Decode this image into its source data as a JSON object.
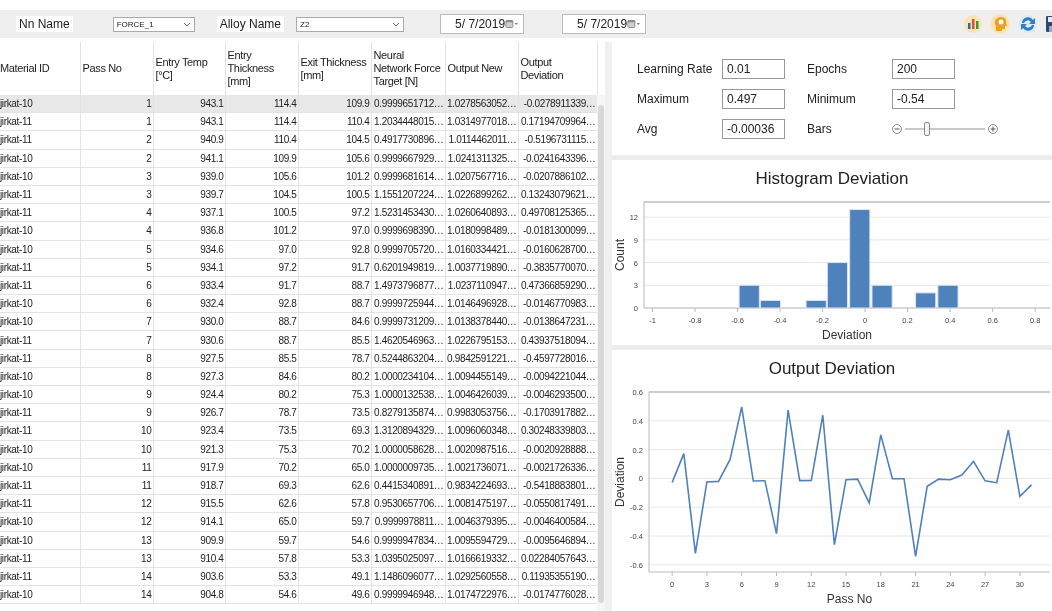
{
  "toolbar": {
    "fields": [
      {
        "label": "Nn Name",
        "value": "FORCE_1"
      },
      {
        "label": "Alloy Name",
        "value": "Z2"
      }
    ],
    "dates": [
      "5/ 7/2019",
      "5/ 7/2019"
    ]
  },
  "table": {
    "columns": [
      "Material ID",
      "Pass No",
      "Entry Temp [°C]",
      "Entry Thickness [mm]",
      "Exit Thickness [mm]",
      "Neural Network Force Target [N]",
      "Output New",
      "Output Deviation"
    ],
    "rows": [
      {
        "selected": true,
        "cells": [
          "jirkat-10",
          "1",
          "943.1",
          "114.4",
          "109.9",
          "0.9999651712…",
          "1.0278563052…",
          "-0.0278911339…"
        ]
      },
      {
        "selected": false,
        "cells": [
          "jirkat-11",
          "1",
          "943.1",
          "114.4",
          "110.4",
          "1.2034448015…",
          "1.0314977018…",
          "0.17194709964…"
        ]
      },
      {
        "selected": false,
        "cells": [
          "jirkat-11",
          "2",
          "940.9",
          "110.4",
          "104.5",
          "0.4917730896…",
          "1.0114462011…",
          "-0.5196731115…"
        ]
      },
      {
        "selected": false,
        "cells": [
          "jirkat-10",
          "2",
          "941.1",
          "109.9",
          "105.6",
          "0.9999667929…",
          "1.0241311325…",
          "-0.0241643396…"
        ]
      },
      {
        "selected": false,
        "cells": [
          "jirkat-10",
          "3",
          "939.0",
          "105.6",
          "101.2",
          "0.9999681614…",
          "1.0207567716…",
          "-0.0207886102…"
        ]
      },
      {
        "selected": false,
        "cells": [
          "jirkat-11",
          "3",
          "939.7",
          "104.5",
          "100.5",
          "1.1551207224…",
          "1.0226899262…",
          "0.13243079621…"
        ]
      },
      {
        "selected": false,
        "cells": [
          "jirkat-11",
          "4",
          "937.1",
          "100.5",
          "97.2",
          "1.5231453430…",
          "1.0260640893…",
          "0.49708125365…"
        ]
      },
      {
        "selected": false,
        "cells": [
          "jirkat-10",
          "4",
          "936.8",
          "101.2",
          "97.0",
          "0.9999698390…",
          "1.0180998489…",
          "-0.0181300099…"
        ]
      },
      {
        "selected": false,
        "cells": [
          "jirkat-10",
          "5",
          "934.6",
          "97.0",
          "92.8",
          "0.9999705720…",
          "1.0160334421…",
          "-0.0160628700…"
        ]
      },
      {
        "selected": false,
        "cells": [
          "jirkat-11",
          "5",
          "934.1",
          "97.2",
          "91.7",
          "0.6201949819…",
          "1.0037719890…",
          "-0.3835770070…"
        ]
      },
      {
        "selected": false,
        "cells": [
          "jirkat-11",
          "6",
          "933.4",
          "91.7",
          "88.7",
          "1.4973796877…",
          "1.0237110947…",
          "0.47366859290…"
        ]
      },
      {
        "selected": false,
        "cells": [
          "jirkat-10",
          "6",
          "932.4",
          "92.8",
          "88.7",
          "0.9999725944…",
          "1.0146496928…",
          "-0.0146770983…"
        ]
      },
      {
        "selected": false,
        "cells": [
          "jirkat-10",
          "7",
          "930.0",
          "88.7",
          "84.6",
          "0.9999731209…",
          "1.0138378440…",
          "-0.0138647231…"
        ]
      },
      {
        "selected": false,
        "cells": [
          "jirkat-11",
          "7",
          "930.6",
          "88.7",
          "85.5",
          "1.4620546963…",
          "1.0226795153…",
          "0.43937518094…"
        ]
      },
      {
        "selected": false,
        "cells": [
          "jirkat-11",
          "8",
          "927.5",
          "85.5",
          "78.7",
          "0.5244863204…",
          "0.9842591221…",
          "-0.4597728016…"
        ]
      },
      {
        "selected": false,
        "cells": [
          "jirkat-10",
          "8",
          "927.3",
          "84.6",
          "80.2",
          "1.0000234104…",
          "1.0094455149…",
          "-0.0094221044…"
        ]
      },
      {
        "selected": false,
        "cells": [
          "jirkat-10",
          "9",
          "924.4",
          "80.2",
          "75.3",
          "1.0000132538…",
          "1.0046426039…",
          "-0.0046293500…"
        ]
      },
      {
        "selected": false,
        "cells": [
          "jirkat-11",
          "9",
          "926.7",
          "78.7",
          "73.5",
          "0.8279135874…",
          "0.9983053756…",
          "-0.1703917882…"
        ]
      },
      {
        "selected": false,
        "cells": [
          "jirkat-11",
          "10",
          "923.4",
          "73.5",
          "69.3",
          "1.3120894329…",
          "1.0096060348…",
          "0.30248339803…"
        ]
      },
      {
        "selected": false,
        "cells": [
          "jirkat-10",
          "10",
          "921.3",
          "75.3",
          "70.2",
          "1.0000058628…",
          "1.0020987516…",
          "-0.0020928888…"
        ]
      },
      {
        "selected": false,
        "cells": [
          "jirkat-10",
          "11",
          "917.9",
          "70.2",
          "65.0",
          "1.0000009735…",
          "1.0021736071…",
          "-0.0021726336…"
        ]
      },
      {
        "selected": false,
        "cells": [
          "jirkat-11",
          "11",
          "918.7",
          "69.3",
          "62.6",
          "0.4415340891…",
          "0.9834224693…",
          "-0.5418883801…"
        ]
      },
      {
        "selected": false,
        "cells": [
          "jirkat-11",
          "12",
          "915.5",
          "62.6",
          "57.8",
          "0.9530657706…",
          "1.0081475197…",
          "-0.0550817491…"
        ]
      },
      {
        "selected": false,
        "cells": [
          "jirkat-10",
          "12",
          "914.1",
          "65.0",
          "59.7",
          "0.9999978811…",
          "1.0046379395…",
          "-0.0046400584…"
        ]
      },
      {
        "selected": false,
        "cells": [
          "jirkat-10",
          "13",
          "909.9",
          "59.7",
          "54.6",
          "0.9999947834…",
          "1.0095594729…",
          "-0.0095646894…"
        ]
      },
      {
        "selected": false,
        "cells": [
          "jirkat-11",
          "13",
          "910.4",
          "57.8",
          "53.3",
          "1.0395025097…",
          "1.0166619332…",
          "0.02284057643…"
        ]
      },
      {
        "selected": false,
        "cells": [
          "jirkat-11",
          "14",
          "903.6",
          "53.3",
          "49.1",
          "1.1486096077…",
          "1.0292560558…",
          "0.11935355190…"
        ]
      },
      {
        "selected": false,
        "cells": [
          "jirkat-10",
          "14",
          "904.8",
          "54.6",
          "49.6",
          "0.9999946948…",
          "1.0174722976…",
          "-0.0174776028…"
        ]
      }
    ]
  },
  "parameters": [
    {
      "kind": "field",
      "label": "Learning Rate",
      "value": "0.01"
    },
    {
      "kind": "field",
      "label": "Epochs",
      "value": "200"
    },
    {
      "kind": "field",
      "label": "Maximum",
      "value": "0.497"
    },
    {
      "kind": "field",
      "label": "Minimum",
      "value": "-0.54"
    },
    {
      "kind": "field",
      "label": "Avg",
      "value": "-0.00036"
    },
    {
      "kind": "slider",
      "label": "Bars",
      "level": 0.27
    }
  ],
  "histogram": {
    "chart_data": {
      "type": "bar",
      "title": "Histogram Deviation",
      "xlabel": "Deviation",
      "ylabel": "Count",
      "x": [
        -0.545,
        -0.445,
        -0.23,
        -0.13,
        -0.025,
        0.08,
        0.285,
        0.39
      ],
      "values": [
        3,
        1,
        1,
        6,
        13,
        3,
        2,
        3
      ],
      "xlim": [
        -1.04,
        0.87
      ],
      "ylim": [
        0,
        14
      ],
      "grid": true,
      "xticks": [
        -1,
        -0.8,
        -0.6,
        -0.4,
        -0.2,
        0,
        0.2,
        0.4,
        0.6,
        0.8
      ],
      "yticks": [
        0,
        3,
        6,
        9,
        12
      ]
    }
  },
  "deviation_plot": {
    "chart_data": {
      "type": "line",
      "title": "Output Deviation",
      "xlabel": "Pass No",
      "ylabel": "Deviation",
      "x": [
        0,
        1,
        2,
        3,
        4,
        5,
        6,
        7,
        8,
        9,
        10,
        11,
        12,
        13,
        14,
        15,
        16,
        17,
        18,
        19,
        20,
        21,
        22,
        23,
        24,
        25,
        26,
        27,
        28,
        29,
        30,
        31
      ],
      "grid": true,
      "series": [
        {
          "color": "#4f81bd",
          "values": [
            -0.028,
            0.172,
            -0.52,
            -0.024,
            -0.021,
            0.132,
            0.497,
            -0.018,
            -0.016,
            -0.384,
            0.474,
            -0.015,
            -0.014,
            0.439,
            -0.46,
            -0.009,
            -0.005,
            -0.17,
            0.302,
            -0.002,
            -0.002,
            -0.542,
            -0.055,
            -0.005,
            -0.01,
            0.023,
            0.119,
            -0.017,
            -0.03,
            0.335,
            -0.125,
            -0.045
          ]
        }
      ],
      "xlim": [
        -2,
        32.6
      ],
      "ylim": [
        -0.65,
        0.6
      ],
      "xticks": [
        0,
        3,
        6,
        9,
        12,
        15,
        18,
        21,
        24,
        27,
        30
      ],
      "yticks": [
        {
          "value": -0.6,
          "label": "-0.6"
        },
        {
          "value": -0.4,
          "label": "-0.4"
        },
        {
          "value": -0.2,
          "label": "-0.2"
        },
        {
          "value": 0,
          "label": "0"
        },
        {
          "value": 0.2,
          "label": "0.2"
        },
        {
          "value": 0.4,
          "label": "0.4"
        },
        {
          "value": 0.6,
          "label": "0.6"
        }
      ]
    }
  }
}
